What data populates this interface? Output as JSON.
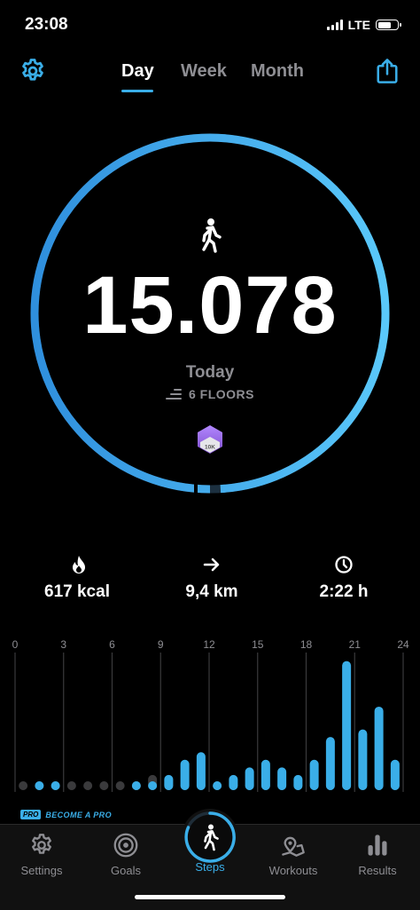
{
  "status_bar": {
    "time": "23:08",
    "network": "LTE",
    "battery_icon": "battery-icon",
    "signal_icon": "signal-icon"
  },
  "header": {
    "settings_icon": "gear-icon",
    "share_icon": "share-icon",
    "tabs": [
      {
        "label": "Day",
        "active": true
      },
      {
        "label": "Week",
        "active": false
      },
      {
        "label": "Month",
        "active": false
      }
    ]
  },
  "summary": {
    "steps": "15.078",
    "period_label": "Today",
    "floors": "6 FLOORS",
    "badge_text": "10K",
    "goal_progress": 0.99
  },
  "stats": [
    {
      "icon": "flame-icon",
      "value": "617 kcal"
    },
    {
      "icon": "arrow-right-icon",
      "value": "9,4 km"
    },
    {
      "icon": "clock-icon",
      "value": "2:22 h"
    }
  ],
  "hour_chart": {
    "tick_labels": [
      "0",
      "3",
      "6",
      "9",
      "12",
      "15",
      "18",
      "21",
      "24"
    ],
    "current_day": [
      0,
      1,
      1,
      0,
      0,
      0,
      0,
      1,
      1,
      2,
      4,
      5,
      1,
      2,
      3,
      4,
      3,
      2,
      4,
      7,
      17,
      8,
      11,
      4
    ],
    "comparison": [
      1,
      0,
      0,
      1,
      1,
      1,
      1,
      0,
      2,
      2,
      0,
      0,
      1,
      0,
      0,
      0,
      0,
      0,
      0,
      0,
      0,
      0,
      0,
      0
    ]
  },
  "promo": {
    "badge": "PRO",
    "text": "BECOME A PRO"
  },
  "nav": [
    {
      "label": "Settings",
      "icon": "gear-icon",
      "active": false
    },
    {
      "label": "Goals",
      "icon": "target-icon",
      "active": false
    },
    {
      "label": "Steps",
      "icon": "walker-icon",
      "active": true
    },
    {
      "label": "Workouts",
      "icon": "map-pin-icon",
      "active": false
    },
    {
      "label": "Results",
      "icon": "bar-chart-icon",
      "active": false
    }
  ],
  "colors": {
    "accent": "#3aaee8",
    "muted": "#8e8e93",
    "comparison_dot": "#3a3a3c",
    "background": "#000000"
  }
}
